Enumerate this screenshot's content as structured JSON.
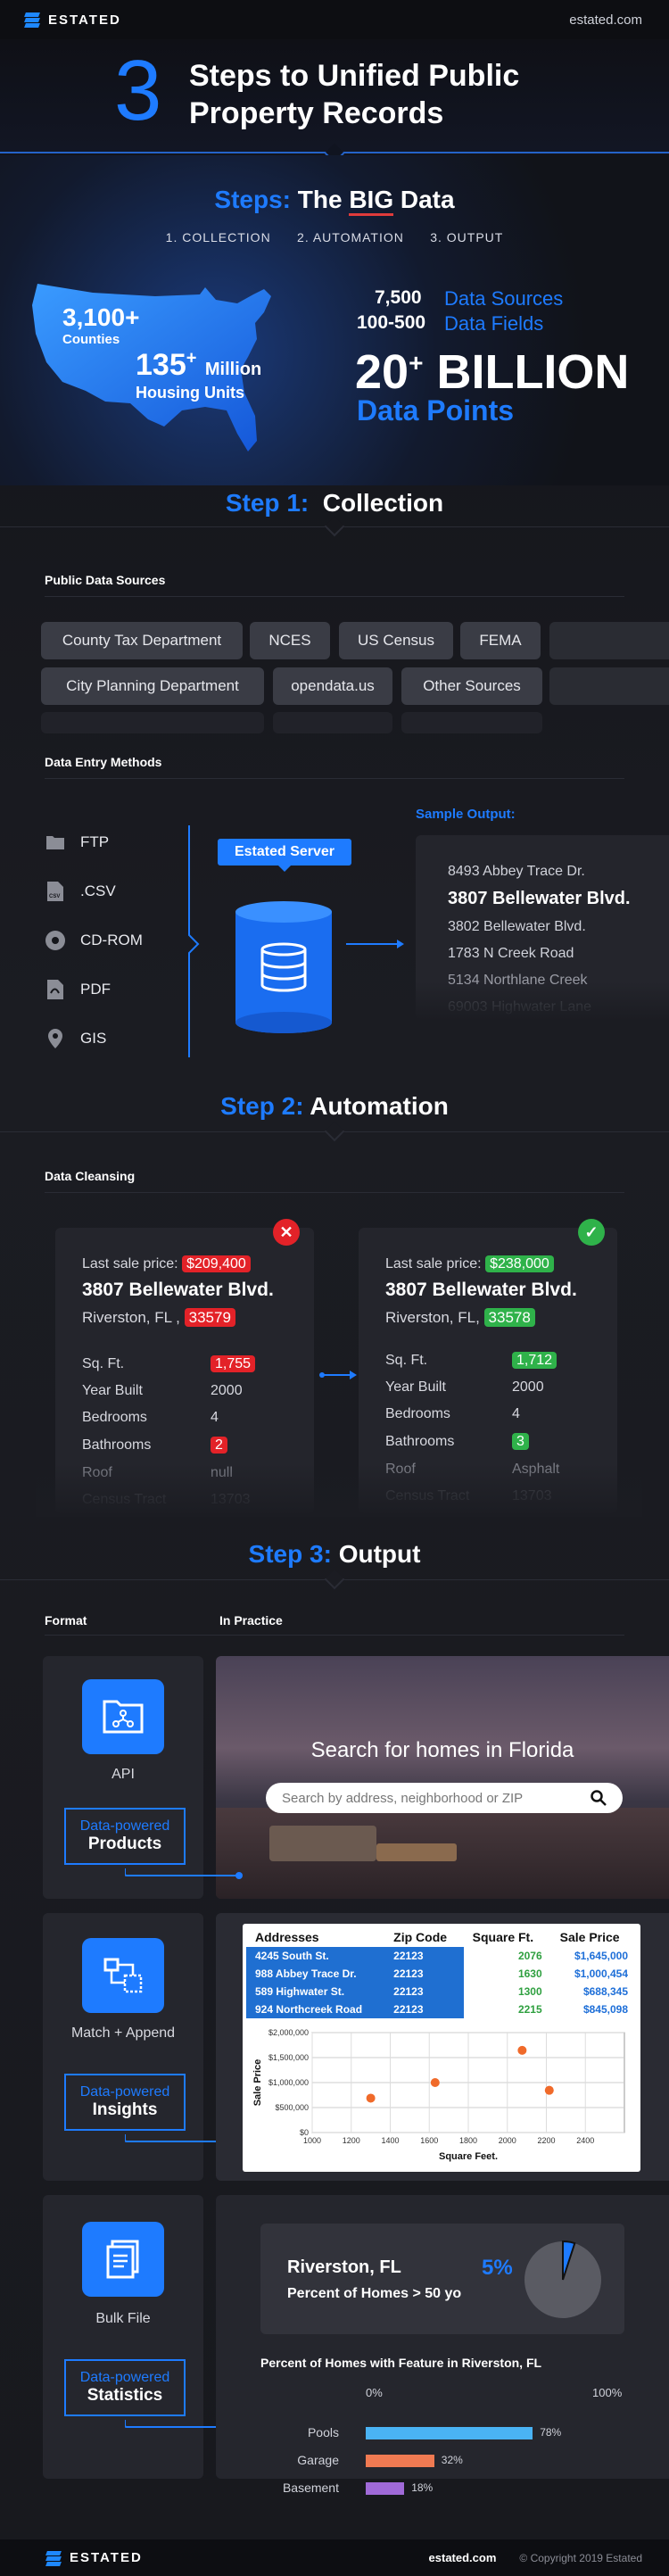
{
  "header": {
    "brand": "ESTATED",
    "site": "estated.com"
  },
  "hero": {
    "number": "3",
    "title": "Steps to Unified Public Property Records"
  },
  "steps_section": {
    "title_prefix": "Steps:",
    "title_the": "The",
    "title_big": "BIG",
    "title_data": "Data",
    "steps": [
      "1. COLLECTION",
      "2. AUTOMATION",
      "3. OUTPUT"
    ],
    "counties_value": "3,100+",
    "counties_label": "Counties",
    "housing_value": "135",
    "housing_sup": "+",
    "housing_unit": "Million",
    "housing_label": "Housing Units",
    "sources_value": "7,500",
    "sources_label": "Data Sources",
    "fields_value": "100-500",
    "fields_label": "Data Fields",
    "points_value": "20",
    "points_sup": "+",
    "points_unit": "BILLION",
    "points_label": "Data Points"
  },
  "step1": {
    "prefix": "Step 1:",
    "title": "Collection",
    "sources_heading": "Public Data Sources",
    "sources": [
      "County Tax Department",
      "NCES",
      "US Census",
      "FEMA",
      "City Planning Department",
      "opendata.us",
      "Other Sources"
    ],
    "methods_heading": "Data Entry Methods",
    "methods": [
      {
        "label": "FTP",
        "icon": "folder-icon"
      },
      {
        "label": ".CSV",
        "icon": "csv-file-icon"
      },
      {
        "label": "CD-ROM",
        "icon": "disc-icon"
      },
      {
        "label": "PDF",
        "icon": "pdf-file-icon"
      },
      {
        "label": "GIS",
        "icon": "map-pin-icon"
      }
    ],
    "server_label": "Estated Server",
    "sample_heading": "Sample Output:",
    "sample": [
      "8493 Abbey Trace Dr.",
      "3807 Bellewater Blvd.",
      "3802 Bellewater Blvd.",
      "1783 N Creek Road",
      "5134 Northlane Creek",
      "69003 Highwater Lane"
    ]
  },
  "step2": {
    "prefix": "Step 2:",
    "title": "Automation",
    "heading": "Data Cleansing",
    "bad": {
      "price_label": "Last sale price:",
      "price": "$209,400",
      "address": "3807 Bellewater Blvd.",
      "city": "Riverston, FL ,",
      "zip": "33579",
      "rows": [
        [
          "Sq. Ft.",
          "1,755"
        ],
        [
          "Year Built",
          "2000"
        ],
        [
          "Bedrooms",
          "4"
        ],
        [
          "Bathrooms",
          "2"
        ],
        [
          "Roof",
          "null"
        ],
        [
          "Census Tract",
          "13703"
        ]
      ]
    },
    "good": {
      "price_label": "Last sale price:",
      "price": "$238,000",
      "address": "3807 Bellewater Blvd.",
      "city": "Riverston, FL,",
      "zip": "33578",
      "rows": [
        [
          "Sq. Ft.",
          "1,712"
        ],
        [
          "Year Built",
          "2000"
        ],
        [
          "Bedrooms",
          "4"
        ],
        [
          "Bathrooms",
          "3"
        ],
        [
          "Roof",
          "Asphalt"
        ],
        [
          "Census Tract",
          "13703"
        ]
      ]
    }
  },
  "step3": {
    "prefix": "Step 3:",
    "title": "Output",
    "format_heading": "Format",
    "practice_heading": "In Practice",
    "api": {
      "label": "API",
      "small": "Data-powered",
      "big": "Products",
      "search_title": "Search for homes in Florida",
      "search_placeholder": "Search by address, neighborhood or ZIP"
    },
    "match": {
      "label": "Match + Append",
      "small": "Data-powered",
      "big": "Insights",
      "table_headers": [
        "Addresses",
        "Zip Code",
        "Square Ft.",
        "Sale Price"
      ],
      "table_rows": [
        [
          "4245 South St.",
          "22123",
          "2076",
          "$1,645,000"
        ],
        [
          "988 Abbey Trace Dr.",
          "22123",
          "1630",
          "$1,000,454"
        ],
        [
          "589 Highwater St.",
          "22123",
          "1300",
          "$688,345"
        ],
        [
          "924 Northcreek Road",
          "22123",
          "2215",
          "$845,098"
        ]
      ]
    },
    "bulk": {
      "label": "Bulk File",
      "small": "Data-powered",
      "big": "Statistics",
      "city": "Riverston, FL",
      "pct": "5%",
      "pct_label": "Percent of Homes > 50 yo",
      "bars_title": "Percent of Homes with Feature in Riverston, FL",
      "axis_min": "0%",
      "axis_max": "100%",
      "bars": [
        {
          "label": "Pools",
          "value": 78,
          "text": "78%",
          "color": "#4ab3f4"
        },
        {
          "label": "Garage",
          "value": 32,
          "text": "32%",
          "color": "#f07a52"
        },
        {
          "label": "Basement",
          "value": 18,
          "text": "18%",
          "color": "#a06ad8"
        }
      ]
    }
  },
  "chart_data": {
    "type": "scatter",
    "xlabel": "Square Feet.",
    "ylabel": "Sale Price",
    "xlim": [
      1000,
      2600
    ],
    "ylim": [
      0,
      2000000
    ],
    "x_ticks": [
      "1000",
      "1200",
      "1400",
      "1600",
      "1800",
      "2000",
      "2200",
      "2400"
    ],
    "y_ticks": [
      "$0",
      "$500,000",
      "$1,000,000",
      "$1,500,000",
      "$2,000,000"
    ],
    "points": [
      {
        "x": 1300,
        "y": 688345
      },
      {
        "x": 1630,
        "y": 1000454
      },
      {
        "x": 2076,
        "y": 1645000
      },
      {
        "x": 2215,
        "y": 845098
      }
    ],
    "color": "#f06a2a"
  },
  "footer": {
    "brand": "ESTATED",
    "site": "estated.com",
    "copyright": "© Copyright 2019 Estated"
  }
}
